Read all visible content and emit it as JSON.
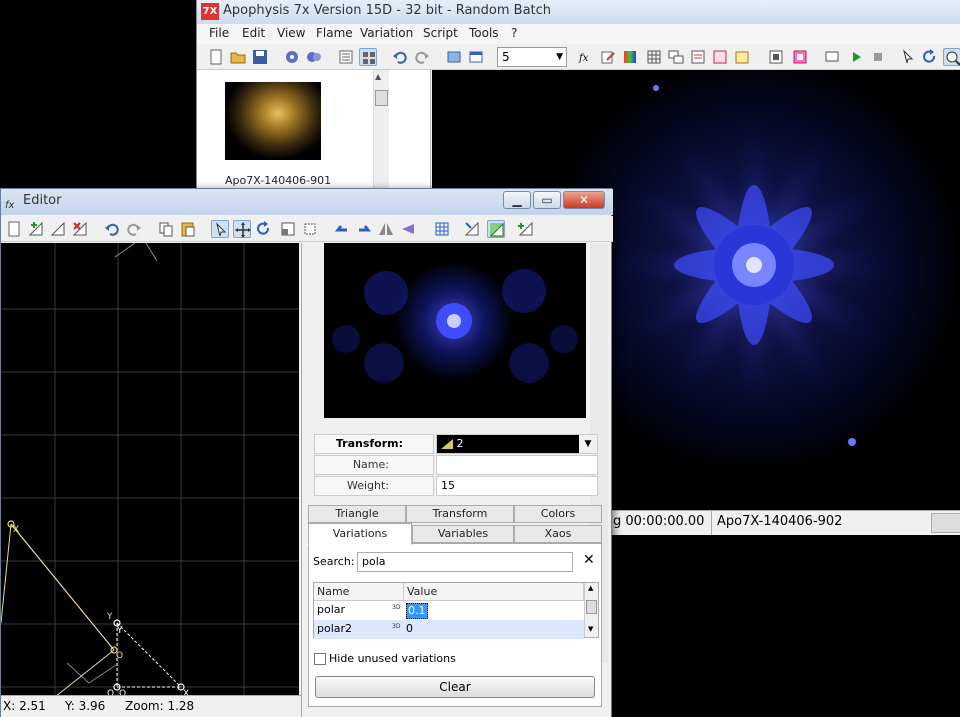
{
  "main_window": {
    "title": "Apophysis 7x Version 15D  - 32 bit - Random Batch",
    "logo_text": "7X",
    "menu": [
      "File",
      "Edit",
      "View",
      "Flame",
      "Variation",
      "Script",
      "Tools",
      "?"
    ],
    "batch_count": "5",
    "thumbnail_label": "Apo7X-140406-901",
    "status": {
      "render_time": "g 00:00:00.00",
      "flame_name": "Apo7X-140406-902"
    }
  },
  "editor": {
    "title": "Editor",
    "transform_label": "Transform:",
    "transform_value": "2",
    "name_label": "Name:",
    "name_value": "",
    "weight_label": "Weight:",
    "weight_value": "15",
    "tabs_row1": [
      "Triangle",
      "Transform",
      "Colors"
    ],
    "tabs_row2": [
      "Variations",
      "Variables",
      "Xaos"
    ],
    "search_label": "Search:",
    "search_value": "pola",
    "table_headers": [
      "Name",
      "Value"
    ],
    "variations": [
      {
        "name": "polar",
        "badge": "3D",
        "value": "0.1"
      },
      {
        "name": "polar2",
        "badge": "3D",
        "value": "0"
      }
    ],
    "hide_unused_label": "Hide unused variations",
    "hide_unused_checked": false,
    "clear_label": "Clear",
    "status": {
      "x": "X: 2.51",
      "y": "Y: 3.96",
      "zoom": "Zoom: 1.28"
    },
    "triangle_labels": {
      "x_ref": "X",
      "y_ref": "Y",
      "o_ref": "O",
      "x_sel": "X",
      "y_sel": "Y",
      "o_sel": "O",
      "o_sel2": "O"
    }
  },
  "colors": {
    "flame_blue": "#3f4cff",
    "triangle_yellow": "#e8e080",
    "selection_highlight": "#3399ff"
  }
}
